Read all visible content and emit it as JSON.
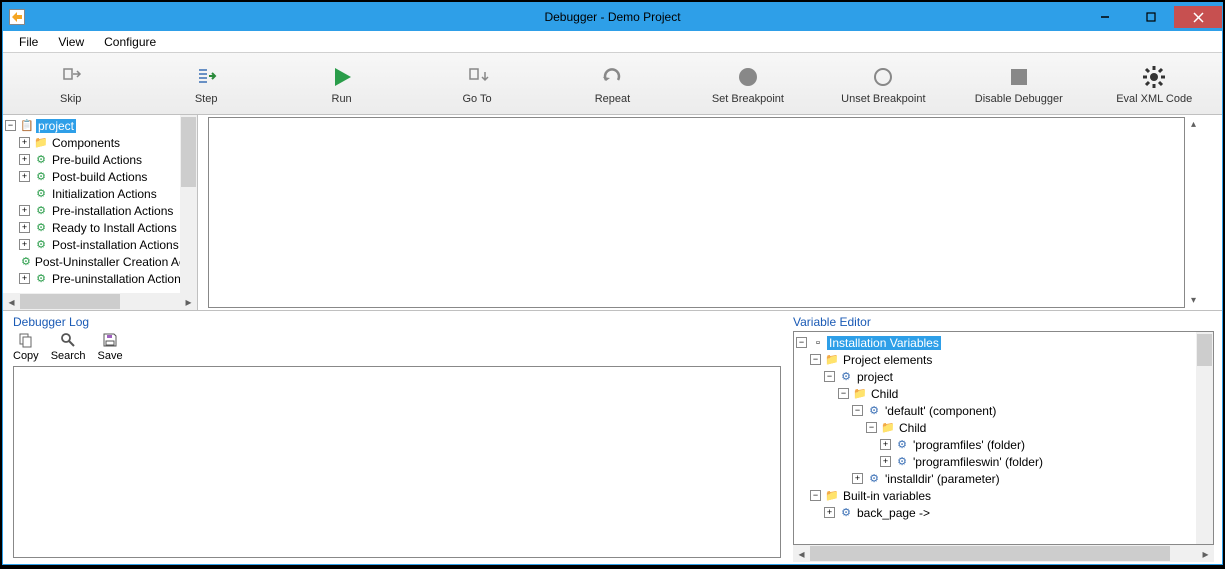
{
  "window": {
    "title": "Debugger - Demo Project"
  },
  "menubar": {
    "items": [
      "File",
      "View",
      "Configure"
    ]
  },
  "toolbar": {
    "items": [
      {
        "label": "Skip",
        "icon": "skip"
      },
      {
        "label": "Step",
        "icon": "step"
      },
      {
        "label": "Run",
        "icon": "run"
      },
      {
        "label": "Go To",
        "icon": "goto"
      },
      {
        "label": "Repeat",
        "icon": "repeat"
      },
      {
        "label": "Set Breakpoint",
        "icon": "set-bp"
      },
      {
        "label": "Unset Breakpoint",
        "icon": "unset-bp"
      },
      {
        "label": "Disable Debugger",
        "icon": "disable"
      },
      {
        "label": "Eval XML Code",
        "icon": "eval"
      }
    ]
  },
  "project_tree": {
    "root": "project",
    "items": [
      {
        "label": "Components",
        "icon": "folder"
      },
      {
        "label": "Pre-build Actions",
        "icon": "gear"
      },
      {
        "label": "Post-build Actions",
        "icon": "gear"
      },
      {
        "label": "Initialization Actions",
        "icon": "gear"
      },
      {
        "label": "Pre-installation Actions",
        "icon": "gear"
      },
      {
        "label": "Ready to Install Actions",
        "icon": "gear"
      },
      {
        "label": "Post-installation Actions",
        "icon": "gear"
      },
      {
        "label": "Post-Uninstaller Creation Actions",
        "icon": "gear"
      },
      {
        "label": "Pre-uninstallation Actions",
        "icon": "gear"
      }
    ]
  },
  "debugger_log": {
    "title": "Debugger Log",
    "tools": [
      {
        "label": "Copy",
        "icon": "copy"
      },
      {
        "label": "Search",
        "icon": "search"
      },
      {
        "label": "Save",
        "icon": "save"
      }
    ]
  },
  "variable_editor": {
    "title": "Variable Editor",
    "root": "Installation Variables",
    "nodes": {
      "project_elements": "Project elements",
      "project": "project",
      "child1": "Child",
      "default_comp": "'default' (component)",
      "child2": "Child",
      "programfiles": "'programfiles' (folder)",
      "programfileswin": "'programfileswin' (folder)",
      "installdir": "'installdir' (parameter)",
      "builtin": "Built-in variables",
      "back_page": "back_page ->"
    }
  }
}
